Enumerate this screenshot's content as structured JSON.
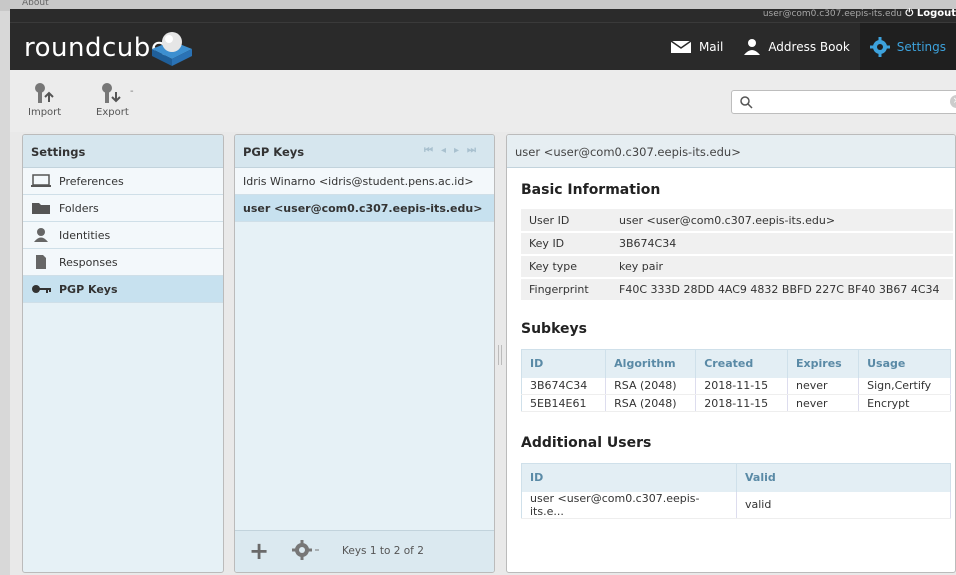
{
  "top": {
    "about": "About",
    "user": "user@com0.c307.eepis-its.edu",
    "logout": "Logout"
  },
  "logo": {
    "text": "roundcube"
  },
  "nav": [
    {
      "label": "Mail",
      "icon": "mail-icon"
    },
    {
      "label": "Address Book",
      "icon": "contact-icon"
    },
    {
      "label": "Settings",
      "icon": "gear-icon"
    }
  ],
  "toolbar": {
    "import_label": "Import",
    "export_label": "Export",
    "search_placeholder": ""
  },
  "settings": {
    "title": "Settings",
    "items": [
      {
        "label": "Preferences",
        "icon": "monitor-icon"
      },
      {
        "label": "Folders",
        "icon": "folder-icon"
      },
      {
        "label": "Identities",
        "icon": "identity-icon"
      },
      {
        "label": "Responses",
        "icon": "document-icon"
      },
      {
        "label": "PGP Keys",
        "icon": "key-icon"
      }
    ]
  },
  "keys": {
    "title": "PGP Keys",
    "items": [
      "Idris Winarno <idris@student.pens.ac.id>",
      "user <user@com0.c307.eepis-its.edu>"
    ],
    "count": "Keys 1 to 2 of 2"
  },
  "detail": {
    "title": "user <user@com0.c307.eepis-its.edu>",
    "basic_heading": "Basic Information",
    "basic": [
      {
        "k": "User ID",
        "v": "user <user@com0.c307.eepis-its.edu>"
      },
      {
        "k": "Key ID",
        "v": "3B674C34"
      },
      {
        "k": "Key type",
        "v": "key pair"
      },
      {
        "k": "Fingerprint",
        "v": "F40C 333D 28DD 4AC9 4832 BBFD 227C BF40 3B67 4C34"
      }
    ],
    "subkeys_heading": "Subkeys",
    "subkeys_cols": [
      "ID",
      "Algorithm",
      "Created",
      "Expires",
      "Usage"
    ],
    "subkeys": [
      [
        "3B674C34",
        "RSA (2048)",
        "2018-11-15",
        "never",
        "Sign,Certify"
      ],
      [
        "5EB14E61",
        "RSA (2048)",
        "2018-11-15",
        "never",
        "Encrypt"
      ]
    ],
    "users_heading": "Additional Users",
    "users_cols": [
      "ID",
      "Valid"
    ],
    "users": [
      [
        "user <user@com0.c307.eepis-its.e...",
        "valid"
      ]
    ]
  }
}
